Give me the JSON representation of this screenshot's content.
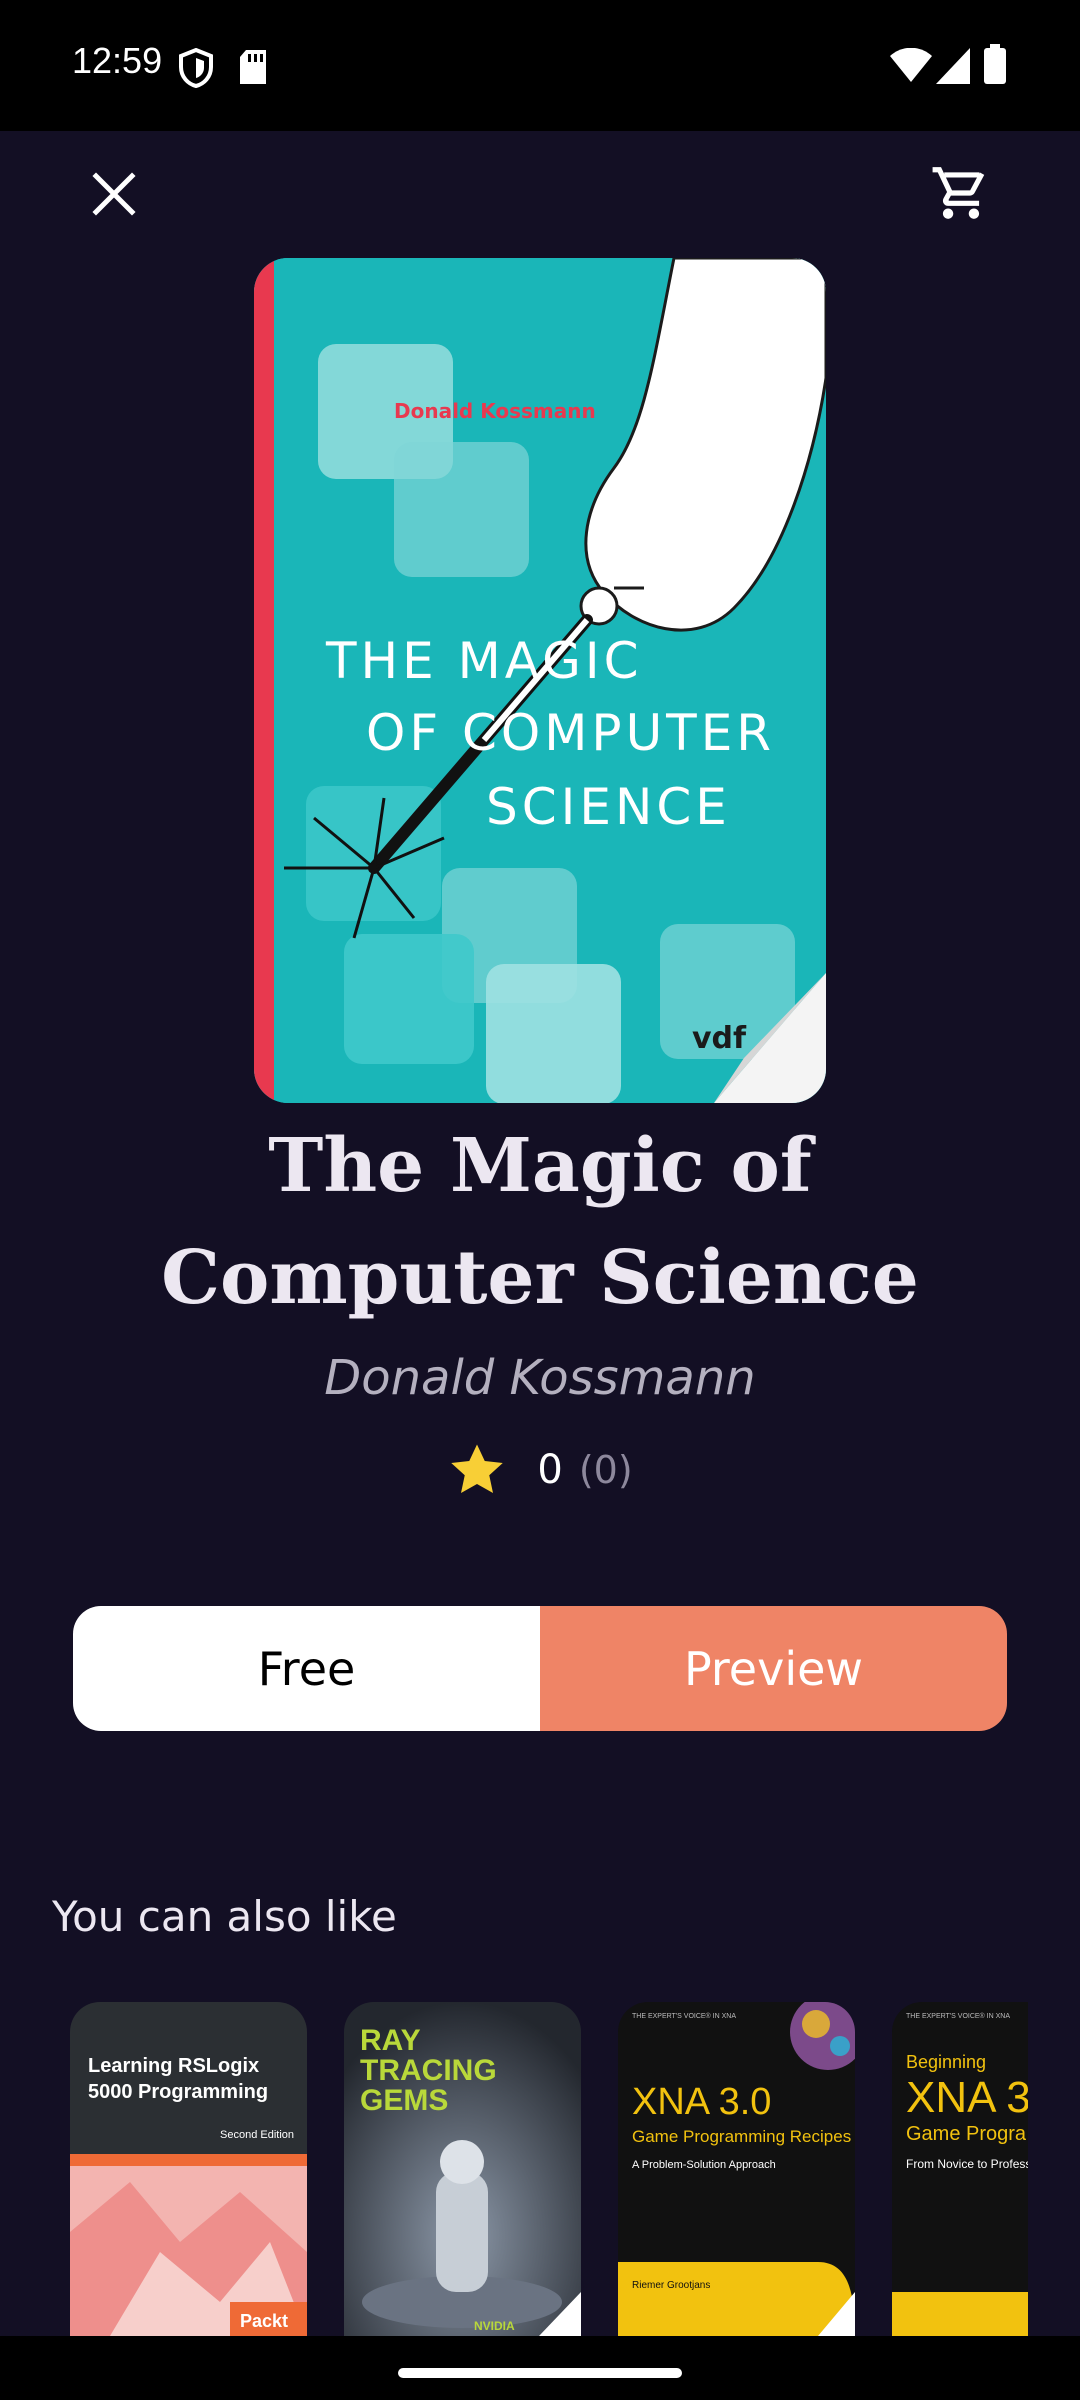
{
  "status_bar": {
    "time": "12:59",
    "icons": [
      "shield-icon",
      "sd-card-icon",
      "wifi-icon",
      "signal-icon",
      "battery-icon"
    ]
  },
  "toolbar": {
    "close_icon": "close-icon",
    "cart_icon": "cart-icon"
  },
  "book": {
    "title": "The Magic of Computer Science",
    "author": "Donald Kossmann",
    "rating": "0",
    "rating_count": "(0)",
    "cover": {
      "author_text": "Donald Kossmann",
      "title_line1": "THE MAGIC",
      "title_line2": "OF COMPUTER",
      "title_line3": "SCIENCE",
      "publisher": "vdf"
    }
  },
  "actions": {
    "free_label": "Free",
    "preview_label": "Preview"
  },
  "recommendations": {
    "section_title": "You can also like",
    "items": [
      {
        "title": "Learning RSLogix 5000 Programming",
        "edition": "Second Edition",
        "publisher": "Packt"
      },
      {
        "title": "RAY TRACING GEMS",
        "publisher": "NVIDIA"
      },
      {
        "series": "THE EXPERT'S VOICE® IN XNA",
        "title": "XNA 3.0",
        "subtitle": "Game Programming Recipes",
        "tagline": "A Problem-Solution Approach",
        "author": "Riemer Grootjans"
      },
      {
        "series": "THE EXPERT'S VOICE® IN XNA",
        "title_pre": "Beginning",
        "title": "XNA 3",
        "subtitle": "Game Progra",
        "tagline": "From Novice to Profess"
      }
    ]
  },
  "colors": {
    "background": "#130f24",
    "accent": "#ef8466",
    "star": "#f8cf36",
    "cover_teal": "#1ab6b8"
  }
}
